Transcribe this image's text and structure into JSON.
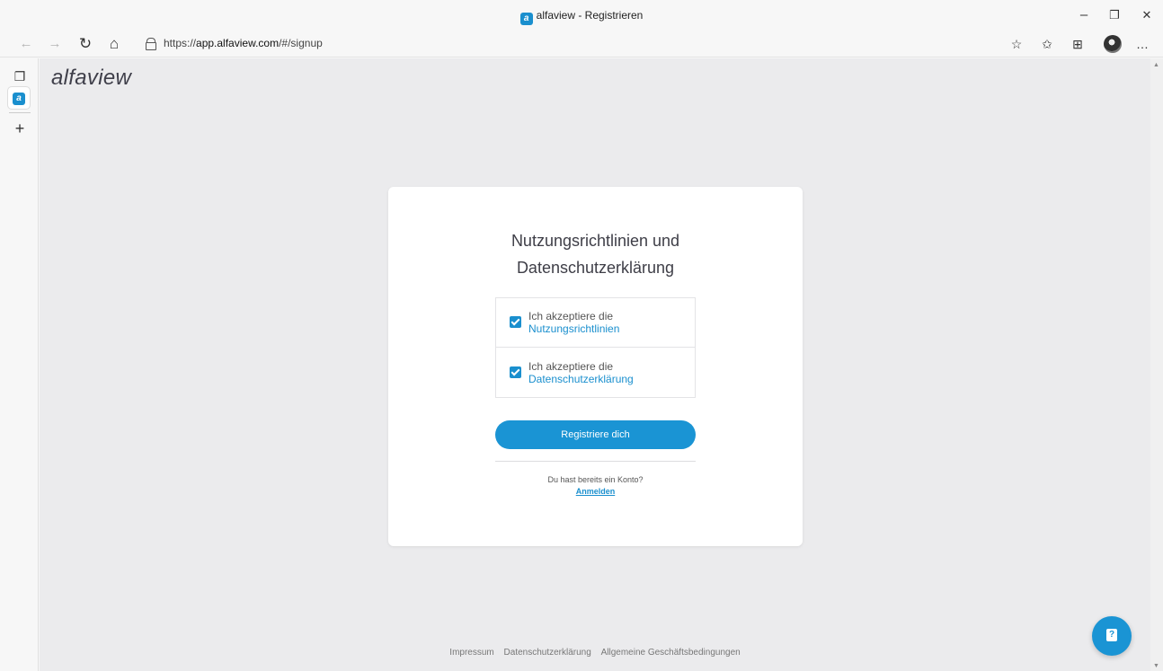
{
  "window": {
    "title": "alfaview - Registrieren",
    "favicon_letter": "a",
    "minimize": "–",
    "restore": "❐",
    "close": "✕"
  },
  "nav": {
    "back": "←",
    "forward": "→",
    "refresh": "↻",
    "home": "⌂",
    "url_prefix": "https://",
    "url_host": "app.alfaview.com",
    "url_path": "/#/signup",
    "favorite_add": "☆",
    "favorites": "✩",
    "collections": "⊞",
    "more": "…"
  },
  "vtabs": {
    "tab_actions": "❐",
    "tab_letter": "a",
    "new_tab": "+"
  },
  "page": {
    "logo": "alfaview",
    "heading_line1": "Nutzungsrichtlinien und",
    "heading_line2": "Datenschutzerklärung",
    "check1_text": "Ich akzeptiere die",
    "check1_link": "Nutzungsrichtlinien",
    "check1_checked": true,
    "check2_text": "Ich akzeptiere die",
    "check2_link": "Datenschutzerklärung",
    "check2_checked": true,
    "register_button": "Registriere dich",
    "have_account": "Du hast bereits ein Konto?",
    "login_link": "Anmelden",
    "help_icon": "?"
  },
  "footer": {
    "impressum": "Impressum",
    "datenschutz": "Datenschutzerklärung",
    "agb": "Allgemeine Geschäftsbedingungen"
  },
  "colors": {
    "accent": "#1a94d4",
    "page_bg": "#ebebed",
    "card_bg": "#ffffff"
  }
}
